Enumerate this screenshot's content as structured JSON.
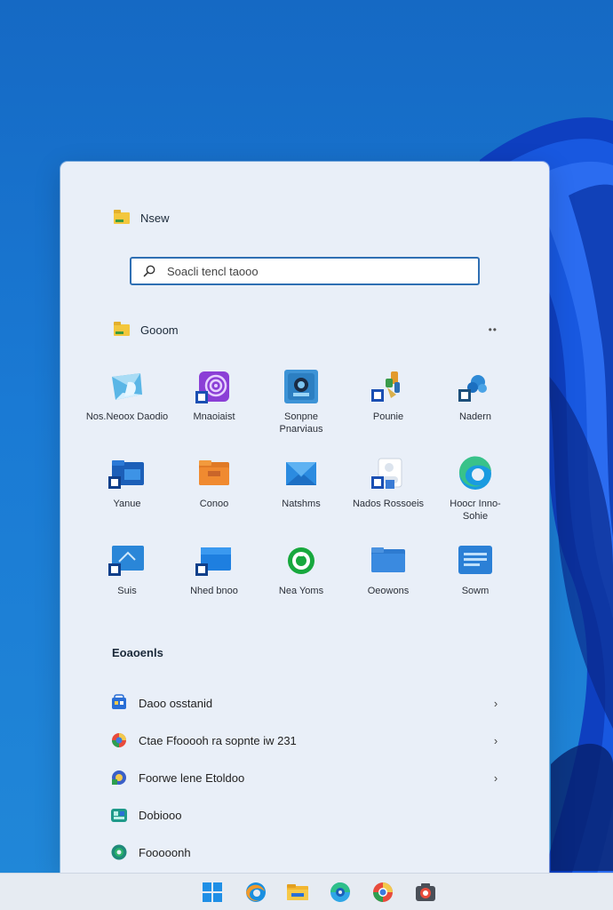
{
  "header": {
    "title": "Nsew"
  },
  "search": {
    "placeholder": "Soacli tencl taooo",
    "value": ""
  },
  "section": {
    "title": "Gooom",
    "more_label": "••"
  },
  "apps": [
    {
      "label": "Nos.Neoox Daodio",
      "icon": "photos-icon"
    },
    {
      "label": "Mnaoiaist",
      "icon": "podcast-icon"
    },
    {
      "label": "Sonpne\nPnarviaus",
      "icon": "camera-app-icon"
    },
    {
      "label": "Pounie",
      "icon": "paint-icon"
    },
    {
      "label": "Nadern",
      "icon": "settings-app-icon"
    },
    {
      "label": "Yanue",
      "icon": "file-explorer-icon"
    },
    {
      "label": "Conoo",
      "icon": "folder-orange-icon"
    },
    {
      "label": "Natshms",
      "icon": "mail-icon"
    },
    {
      "label": "Nados Rossoeis",
      "icon": "user-docs-icon"
    },
    {
      "label": "Hoocr Inno-\nSohie",
      "icon": "edge-icon"
    },
    {
      "label": "Suis",
      "icon": "screen-app-icon"
    },
    {
      "label": "Nhed bnoo",
      "icon": "store-app-icon"
    },
    {
      "label": "Nea Yoms",
      "icon": "green-app-icon"
    },
    {
      "label": "Oeowons",
      "icon": "folder-blue-icon"
    },
    {
      "label": "Sowm",
      "icon": "panel-app-icon"
    }
  ],
  "recommended": {
    "title": "Eoaoenls",
    "items": [
      {
        "label": "Daoo osstanid",
        "icon": "store-doc-icon",
        "has_chevron": true
      },
      {
        "label": "Ctae Ffooooh ra sopnte iw 231",
        "icon": "chrome-doc-icon",
        "has_chevron": true
      },
      {
        "label": "Foorwe lene Etoldoo",
        "icon": "media-doc-icon",
        "has_chevron": true
      },
      {
        "label": "Dobiooo",
        "icon": "music-doc-icon",
        "has_chevron": false
      },
      {
        "label": "Fooooonh",
        "icon": "world-doc-icon",
        "has_chevron": false
      }
    ]
  },
  "taskbar": {
    "items": [
      "start-icon",
      "edge-task-icon",
      "file-explorer-task-icon",
      "browser-task-icon",
      "chrome-task-icon",
      "camera-task-icon"
    ]
  },
  "colors": {
    "accent": "#2f6fb3",
    "panel": "#e9eff8",
    "wallpaper": "#1a7ad4",
    "taskbar": "#e6ebf2"
  }
}
